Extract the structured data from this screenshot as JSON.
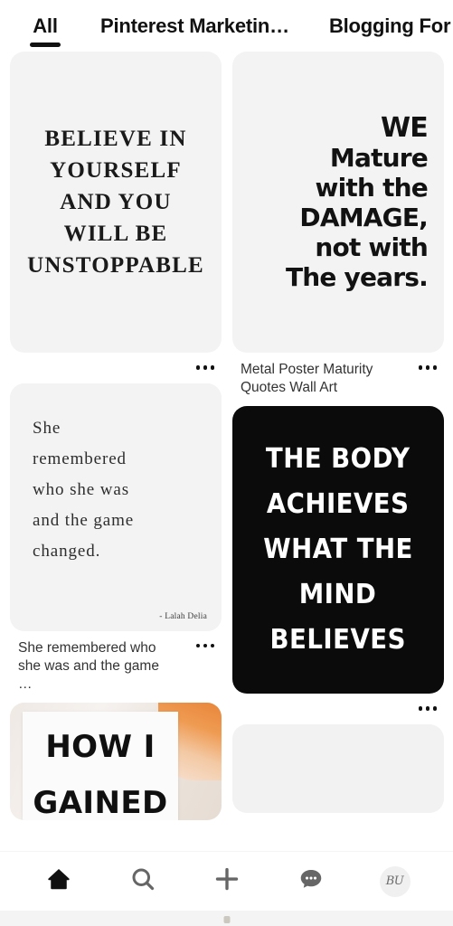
{
  "tabs": [
    {
      "label": "All",
      "active": true
    },
    {
      "label": "Pinterest Marketin…",
      "active": false
    },
    {
      "label": "Blogging For B",
      "active": false
    }
  ],
  "feed": {
    "left_column": [
      {
        "id": "pin-believe",
        "kind": "quote-serif-caps",
        "background": "#f3f3f3",
        "text_color": "#1a1a1a",
        "lines": [
          "BELIEVE IN",
          "YOURSELF",
          "AND YOU",
          "WILL BE",
          "UNSTOPPABLE"
        ],
        "title": "",
        "overflow_label": "···"
      },
      {
        "id": "pin-she-remembered",
        "kind": "quote-serif-light",
        "background": "#f3f3f3",
        "text_color": "#2e2e2e",
        "lines": [
          "She",
          "remembered",
          "who she was",
          "and the game",
          "changed."
        ],
        "attribution": "- Lalah Delia",
        "title": "She remembered who she was and the game …",
        "overflow_label": "···"
      },
      {
        "id": "pin-how-i-gained",
        "kind": "photo-overlay",
        "accent_color": "#e8863a",
        "lines": [
          "HOW I",
          "GAINED"
        ],
        "title": "",
        "overflow_label": "···"
      }
    ],
    "right_column": [
      {
        "id": "pin-we-mature",
        "kind": "quote-sans-bold",
        "background": "#f3f3f3",
        "text_color": "#121212",
        "lines": [
          "WE",
          "Mature",
          "with the",
          "DAMAGE,",
          "not with",
          "The years."
        ],
        "title": "Metal Poster Maturity Quotes Wall Art",
        "overflow_label": "···"
      },
      {
        "id": "pin-body-achieves",
        "kind": "quote-inverted",
        "background": "#0b0b0b",
        "text_color": "#ffffff",
        "lines": [
          "THE BODY",
          "ACHIEVES",
          "WHAT THE",
          "MIND",
          "BELIEVES"
        ],
        "title": "",
        "overflow_label": "···"
      },
      {
        "id": "pin-placeholder",
        "kind": "placeholder",
        "background": "#f2f2f2",
        "lines": [],
        "title": "",
        "overflow_label": ""
      }
    ]
  },
  "bottom_nav": [
    {
      "id": "home",
      "icon": "home-icon",
      "label": "Home",
      "active": true
    },
    {
      "id": "search",
      "icon": "search-icon",
      "label": "Search",
      "active": false
    },
    {
      "id": "create",
      "icon": "plus-icon",
      "label": "Create",
      "active": false
    },
    {
      "id": "updates",
      "icon": "chat-bubble-icon",
      "label": "Messages",
      "active": false
    },
    {
      "id": "profile",
      "icon": "avatar-icon",
      "label": "Profile",
      "active": false,
      "initials": "BU"
    }
  ],
  "colors": {
    "accent_black": "#111111",
    "pin_placeholder": "#f2f2f2",
    "nav_inactive": "#666666",
    "nav_active": "#111111",
    "page_background": "#ffffff",
    "system_bar": "#f4f4f4"
  }
}
